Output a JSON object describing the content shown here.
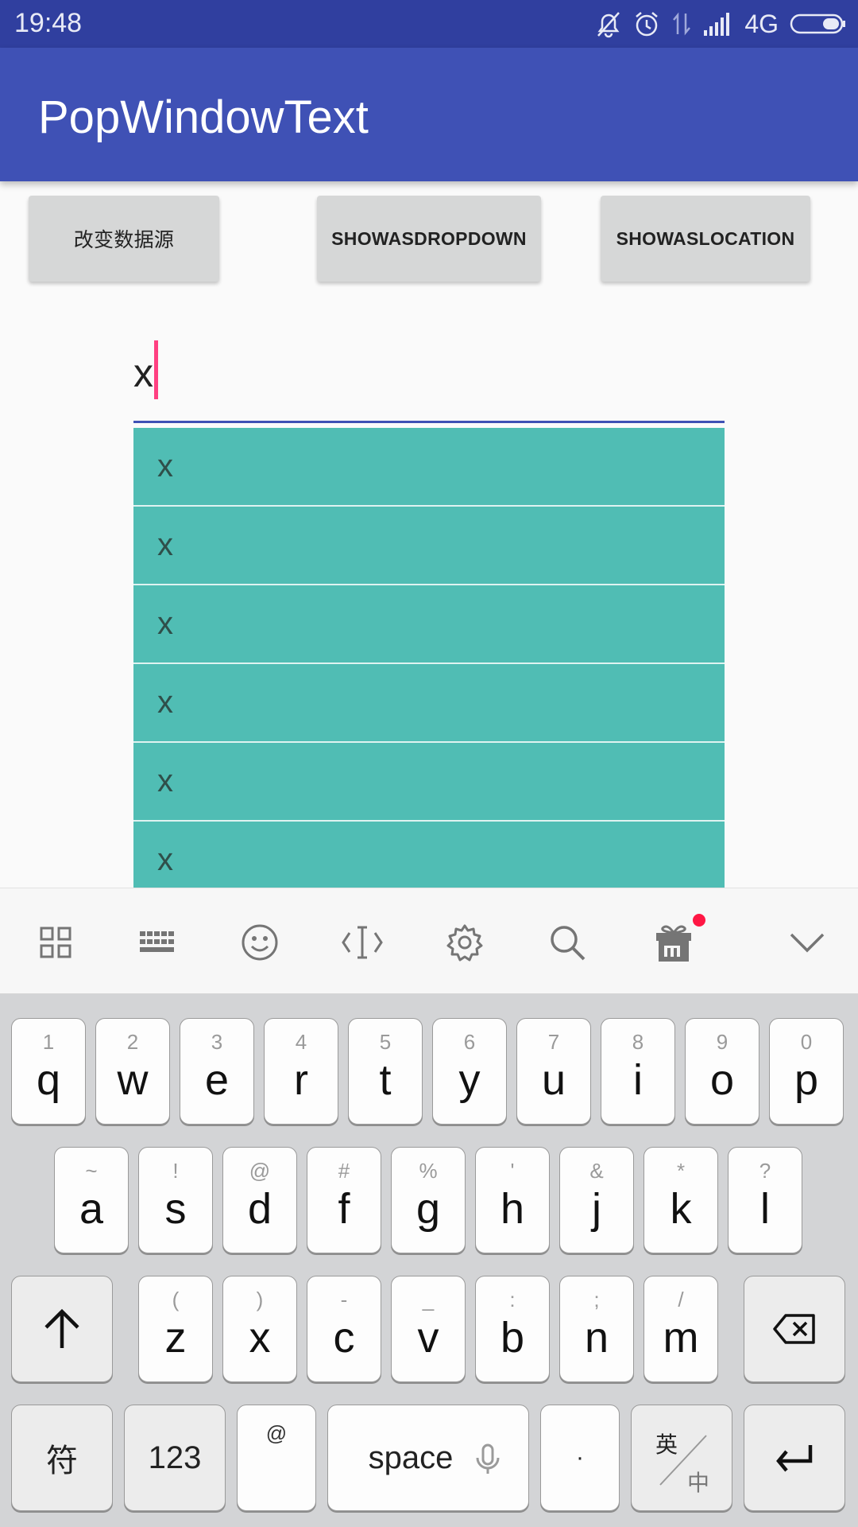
{
  "status_bar": {
    "time": "19:48",
    "network": "4G",
    "icons": [
      "bell-off-icon",
      "alarm-icon",
      "data-transfer-icon",
      "signal-icon",
      "battery-icon"
    ]
  },
  "app_bar": {
    "title": "PopWindowText"
  },
  "buttons": {
    "change_data": "改变数据源",
    "show_as_dropdown": "SHOWASDROPDOWN",
    "show_as_location": "SHOWASLOCATION"
  },
  "edit_text": {
    "value": "x"
  },
  "popup_list": {
    "items": [
      "x",
      "x",
      "x",
      "x",
      "x",
      "x"
    ]
  },
  "keyboard_toolbar": {
    "icons": [
      "grid-icon",
      "keyboard-icon",
      "emoji-icon",
      "cursor-move-icon",
      "gear-icon",
      "search-icon",
      "gift-icon",
      "chevron-down-icon"
    ]
  },
  "keyboard": {
    "row1": [
      {
        "main": "q",
        "hint": "1"
      },
      {
        "main": "w",
        "hint": "2"
      },
      {
        "main": "e",
        "hint": "3"
      },
      {
        "main": "r",
        "hint": "4"
      },
      {
        "main": "t",
        "hint": "5"
      },
      {
        "main": "y",
        "hint": "6"
      },
      {
        "main": "u",
        "hint": "7"
      },
      {
        "main": "i",
        "hint": "8"
      },
      {
        "main": "o",
        "hint": "9"
      },
      {
        "main": "p",
        "hint": "0"
      }
    ],
    "row2": [
      {
        "main": "a",
        "hint": "~"
      },
      {
        "main": "s",
        "hint": "!"
      },
      {
        "main": "d",
        "hint": "@"
      },
      {
        "main": "f",
        "hint": "#"
      },
      {
        "main": "g",
        "hint": "%"
      },
      {
        "main": "h",
        "hint": "'"
      },
      {
        "main": "j",
        "hint": "&"
      },
      {
        "main": "k",
        "hint": "*"
      },
      {
        "main": "l",
        "hint": "?"
      }
    ],
    "row3": [
      {
        "main": "z",
        "hint": "("
      },
      {
        "main": "x",
        "hint": ")"
      },
      {
        "main": "c",
        "hint": "-"
      },
      {
        "main": "v",
        "hint": "_"
      },
      {
        "main": "b",
        "hint": ":"
      },
      {
        "main": "n",
        "hint": ";"
      },
      {
        "main": "m",
        "hint": "/"
      }
    ],
    "bottom": {
      "symbols": "符",
      "numbers": "123",
      "at": "@",
      "space": "space",
      "period": "·",
      "lang_top": "英",
      "lang_bottom": "中"
    }
  }
}
